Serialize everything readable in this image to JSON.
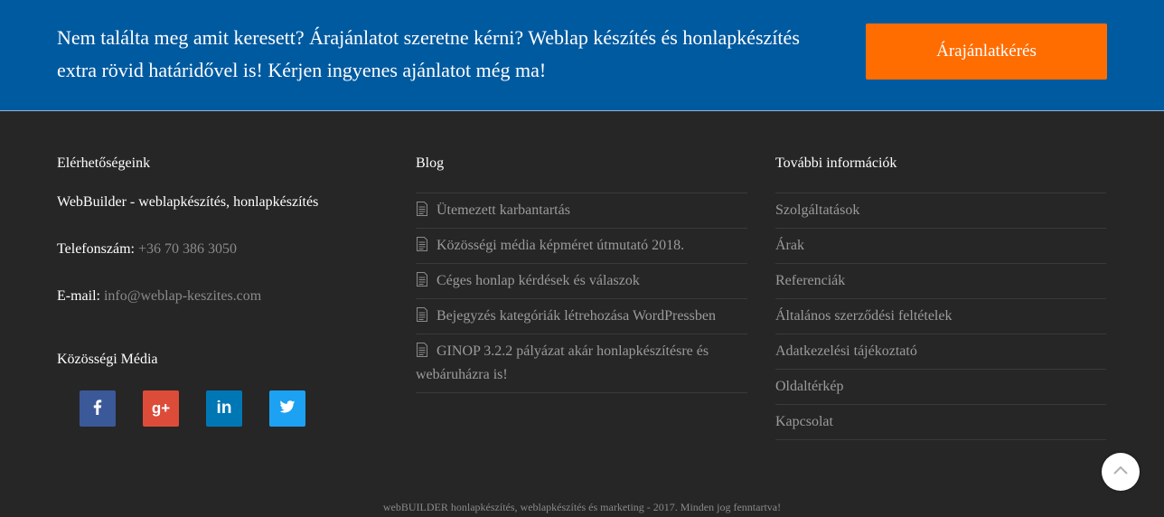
{
  "cta": {
    "text": "Nem találta meg amit keresett? Árajánlatot szeretne kérni? Weblap készítés és honlapkészítés extra rövid határidővel is! Kérjen ingyenes ajánlatot még ma!",
    "button_label": "Árajánlatkérés"
  },
  "contact": {
    "title": "Elérhetőségeink",
    "company": "WebBuilder - weblapkészítés, honlapkészítés",
    "phone_label": "Telefonszám:",
    "phone": "+36 70 386 3050",
    "email_label": "E-mail:",
    "email": "info@weblap-keszites.com"
  },
  "social": {
    "title": "Közösségi Média",
    "items": [
      {
        "name": "facebook",
        "icon": "facebook-icon",
        "color": "#3b5998"
      },
      {
        "name": "google-plus",
        "icon": "google-plus-icon",
        "color": "#dd4b39"
      },
      {
        "name": "linkedin",
        "icon": "linkedin-icon",
        "color": "#0077b5"
      },
      {
        "name": "twitter",
        "icon": "twitter-icon",
        "color": "#1da1f2"
      }
    ]
  },
  "blog": {
    "title": "Blog",
    "items": [
      "Ütemezett karbantartás",
      "Közösségi média képméret útmutató 2018.",
      "Céges honlap kérdések és válaszok",
      "Bejegyzés kategóriák létrehozása WordPressben",
      "GINOP 3.2.2 pályázat akár honlapkészítésre és webáruházra is!"
    ]
  },
  "info": {
    "title": "További információk",
    "items": [
      "Szolgáltatások",
      "Árak",
      "Referenciák",
      "Általános szerződési feltételek",
      "Adatkezelési tájékoztató",
      "Oldaltérkép",
      "Kapcsolat"
    ]
  },
  "footer": {
    "copyright": "webBUILDER honlapkészítés, weblapkészítés és marketing - 2017. Minden jog fenntartva!"
  },
  "colors": {
    "cta_bg": "#005aa0",
    "cta_button": "#ff6c00",
    "footer_bg": "#262626"
  }
}
